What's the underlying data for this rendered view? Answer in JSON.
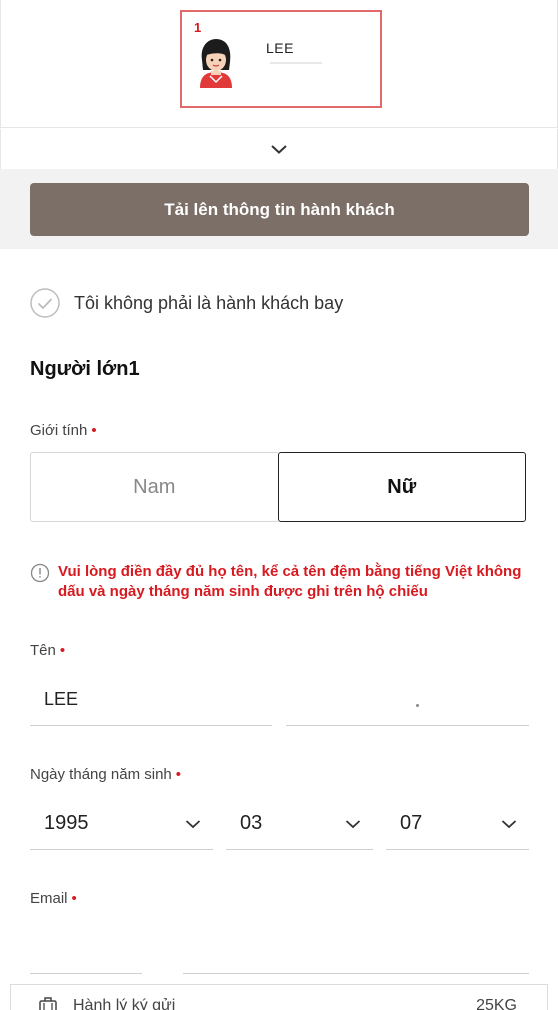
{
  "passenger_card": {
    "number": "1",
    "name": "LEE"
  },
  "upload_button": "Tải lên thông tin hành khách",
  "not_passenger_label": "Tôi không phải là hành khách bay",
  "section_title": "Người lớn1",
  "gender": {
    "label": "Giới tính",
    "male": "Nam",
    "female": "Nữ",
    "selected": "Nữ"
  },
  "warning_text": "Vui lòng điền đầy đủ họ tên, kể cả tên đệm bằng tiếng Việt không dấu và ngày tháng năm sinh được ghi trên hộ chiếu",
  "name_field": {
    "label": "Tên",
    "last_name": "LEE",
    "first_name": ""
  },
  "dob": {
    "label": "Ngày tháng năm sinh",
    "year": "1995",
    "month": "03",
    "day": "07"
  },
  "email": {
    "label": "Email",
    "local_part": "",
    "domain": ""
  },
  "required_mark": "•",
  "baggage": {
    "label": "Hành lý ký gửi",
    "weight": "25KG"
  },
  "colors": {
    "accent_red": "#d71920",
    "upload_button_bg": "#7b6f67",
    "card_border": "#e06a6a"
  }
}
